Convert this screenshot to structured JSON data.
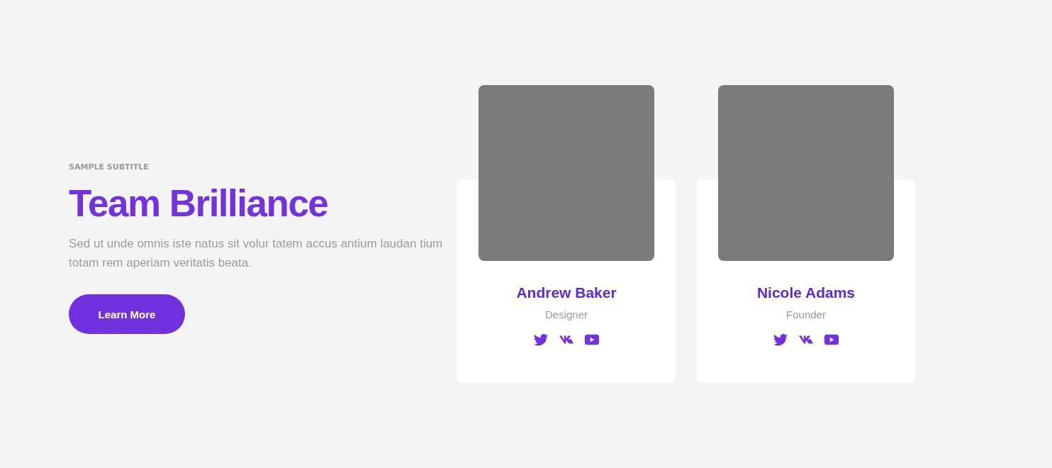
{
  "intro": {
    "subtitle": "SAMPLE SUBTITLE",
    "title": "Team Brilliance",
    "text": "Sed ut unde omnis iste natus sit volur tatem accus antium laudan tium totam rem aperiam veritatis beata.",
    "button": "Learn More"
  },
  "members": [
    {
      "photo": {
        "kind": "placeholder"
      },
      "name": "Andrew Baker",
      "role": "Designer",
      "socials": [
        {
          "kind": "bird"
        },
        {
          "kind": "vk"
        },
        {
          "kind": "play"
        }
      ]
    },
    {
      "photo": {
        "kind": "placeholder"
      },
      "name": "Nicole Adams",
      "role": "Founder",
      "socials": [
        {
          "kind": "bird"
        },
        {
          "kind": "vk"
        },
        {
          "kind": "play"
        }
      ]
    }
  ]
}
